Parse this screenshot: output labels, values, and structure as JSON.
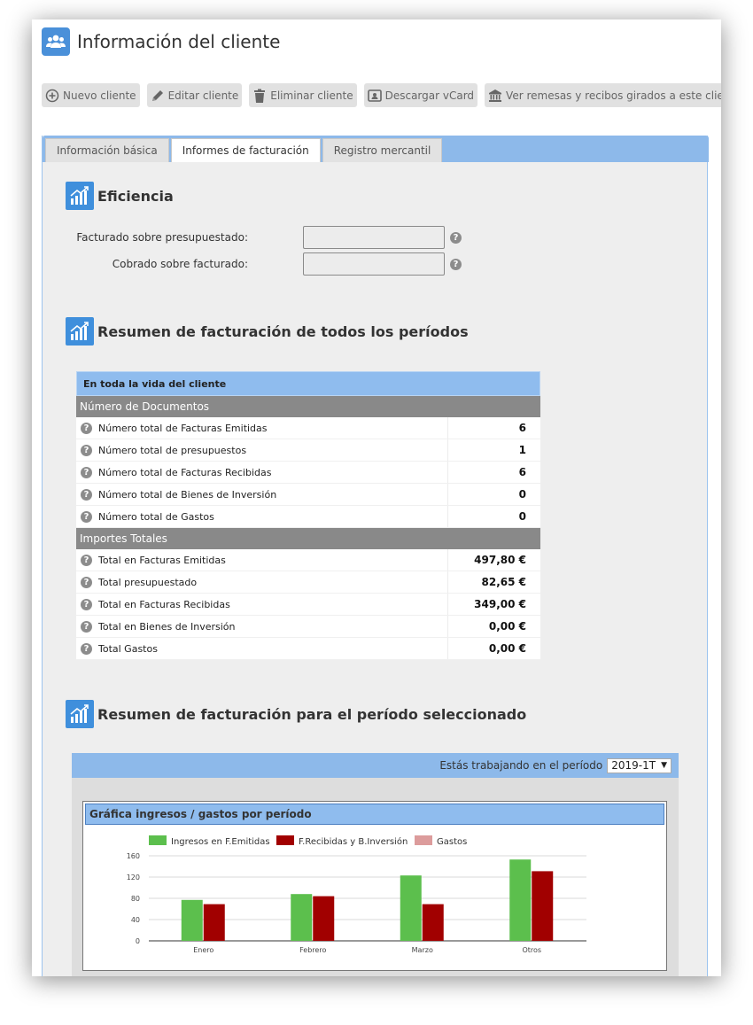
{
  "page": {
    "title": "Información del cliente"
  },
  "toolbar": [
    {
      "label": "Nuevo cliente",
      "icon": "plus-circle-icon"
    },
    {
      "label": "Editar cliente",
      "icon": "pencil-icon"
    },
    {
      "label": "Eliminar cliente",
      "icon": "trash-icon"
    },
    {
      "label": "Descargar vCard",
      "icon": "vcard-icon"
    },
    {
      "label": "Ver remesas y recibos girados a este cliente",
      "icon": "bank-icon"
    }
  ],
  "tabs": [
    {
      "label": "Información básica",
      "active": false
    },
    {
      "label": "Informes de facturación",
      "active": true
    },
    {
      "label": "Registro mercantil",
      "active": false
    }
  ],
  "efficiency": {
    "title": "Eficiencia",
    "rows": [
      {
        "label": "Facturado sobre presupuestado:",
        "value": ""
      },
      {
        "label": "Cobrado sobre facturado:",
        "value": ""
      }
    ]
  },
  "summary_all": {
    "title": "Resumen de facturación de todos los períodos",
    "table_header": "En toda la vida del cliente",
    "groups": [
      {
        "title": "Número de Documentos",
        "rows": [
          {
            "label": "Número total de Facturas Emitidas",
            "value": "6"
          },
          {
            "label": "Número total de presupuestos",
            "value": "1"
          },
          {
            "label": "Número total de Facturas Recibidas",
            "value": "6"
          },
          {
            "label": "Número total de Bienes de Inversión",
            "value": "0"
          },
          {
            "label": "Número total de Gastos",
            "value": "0"
          }
        ]
      },
      {
        "title": "Importes Totales",
        "rows": [
          {
            "label": "Total en Facturas Emitidas",
            "value": "497,80 €"
          },
          {
            "label": "Total presupuestado",
            "value": "82,65 €"
          },
          {
            "label": "Total en Facturas Recibidas",
            "value": "349,00 €"
          },
          {
            "label": "Total en Bienes de Inversión",
            "value": "0,00 €"
          },
          {
            "label": "Total Gastos",
            "value": "0,00 €"
          }
        ]
      }
    ]
  },
  "summary_period": {
    "title": "Resumen de facturación para el período seleccionado",
    "period_label": "Estás trabajando en el período",
    "period_value": "2019-1T"
  },
  "colors": {
    "green": "#5cbf4d",
    "red": "#a10000",
    "pink": "#dc9c9c",
    "accent": "#8db9ea"
  },
  "chart_data": {
    "type": "bar",
    "title": "Gráfica ingresos / gastos por período",
    "categories": [
      "Enero",
      "Febrero",
      "Marzo",
      "Otros"
    ],
    "series": [
      {
        "name": "Ingresos en F.Emitidas",
        "color": "#5cbf4d",
        "values": [
          77,
          88,
          123,
          153
        ]
      },
      {
        "name": "F.Recibidas y B.Inversión",
        "color": "#a10000",
        "values": [
          69,
          84,
          69,
          131
        ]
      },
      {
        "name": "Gastos",
        "color": "#dc9c9c",
        "values": [
          0,
          0,
          0,
          0
        ]
      }
    ],
    "yticks": [
      0,
      40,
      80,
      120,
      160
    ],
    "ylim": [
      0,
      160
    ],
    "legend": "top",
    "grid": true
  }
}
